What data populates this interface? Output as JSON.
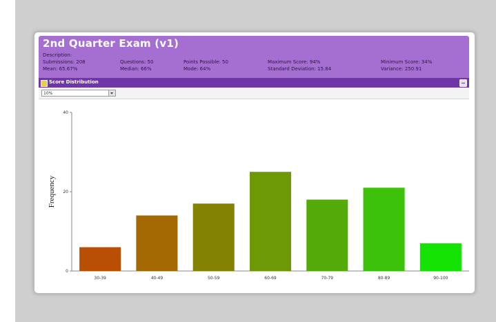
{
  "exam": {
    "title": "2nd Quarter Exam (v1)",
    "description_label": "Description:",
    "stats": {
      "submissions": "Submissions: 208",
      "mean": "Mean: 65.67%",
      "questions": "Questions: 50",
      "median": "Median: 66%",
      "points_possible": "Points Possible: 50",
      "mode": "Mode: 64%",
      "maximum_score": "Maximum Score: 94%",
      "std_dev": "Standard Deviation: 15.84",
      "minimum_score": "Minimum Score: 34%",
      "variance": "Variance: 250.91"
    }
  },
  "panel": {
    "title": "Score Distribution",
    "interval_select": "10%"
  },
  "colors": {
    "header_bg": "#a56fd2",
    "subbar_bg": "#6f36a8"
  },
  "chart_data": {
    "type": "bar",
    "categories": [
      "30-39",
      "40-49",
      "50-59",
      "60-69",
      "70-79",
      "80-89",
      "90-100"
    ],
    "values": [
      6,
      14,
      17,
      25,
      18,
      21,
      7
    ],
    "colors": [
      "#b84f05",
      "#a46903",
      "#838203",
      "#6c9905",
      "#54aa09",
      "#3cc20a",
      "#15e304"
    ],
    "xlabel": "",
    "ylabel": "Frequency",
    "ylim": [
      0,
      30
    ],
    "yticks": [
      0,
      20,
      40
    ],
    "grid": false
  }
}
